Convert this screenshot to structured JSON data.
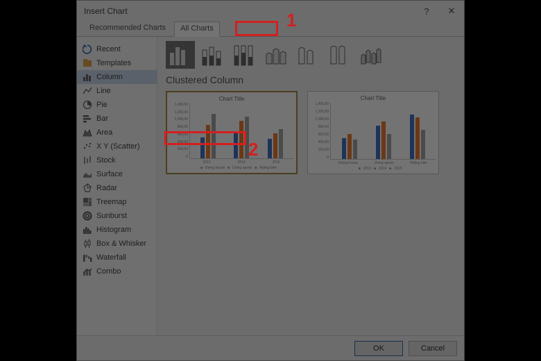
{
  "dialog": {
    "title": "Insert Chart",
    "help": "?",
    "close": "✕"
  },
  "tabs": {
    "recommended": "Recommended Charts",
    "all": "All Charts"
  },
  "sidebar": {
    "items": [
      {
        "label": "Recent"
      },
      {
        "label": "Templates"
      },
      {
        "label": "Column"
      },
      {
        "label": "Line"
      },
      {
        "label": "Pie"
      },
      {
        "label": "Bar"
      },
      {
        "label": "Area"
      },
      {
        "label": "X Y (Scatter)"
      },
      {
        "label": "Stock"
      },
      {
        "label": "Surface"
      },
      {
        "label": "Radar"
      },
      {
        "label": "Treemap"
      },
      {
        "label": "Sunburst"
      },
      {
        "label": "Histogram"
      },
      {
        "label": "Box & Whisker"
      },
      {
        "label": "Waterfall"
      },
      {
        "label": "Combo"
      }
    ]
  },
  "main": {
    "section_title": "Clustered Column",
    "preview_title": "Chart Title",
    "yticks": [
      "1,400,00",
      "1,200,00",
      "1,000,00",
      "800,00",
      "600,00",
      "400,00",
      "200,00",
      "0"
    ],
    "xcats1": [
      "2013",
      "2014",
      "2015"
    ],
    "legend1": [
      "Doing house",
      "Doing sports",
      "Riding bike"
    ],
    "xcats2": [
      "Doing house",
      "Doing sports",
      "Riding bike"
    ],
    "legend2": [
      "2013",
      "2014",
      "2015"
    ]
  },
  "footer": {
    "ok": "OK",
    "cancel": "Cancel"
  },
  "annotations": {
    "n1": "1",
    "n2": "2"
  },
  "chart_data": {
    "type": "bar",
    "title": "Chart Title",
    "ylim": [
      0,
      1400000
    ],
    "previews": [
      {
        "categories": [
          "2013",
          "2014",
          "2015"
        ],
        "series": [
          {
            "name": "Doing house",
            "values": [
              500000,
              600000,
              450000
            ]
          },
          {
            "name": "Doing sports",
            "values": [
              800000,
              900000,
              600000
            ]
          },
          {
            "name": "Riding bike",
            "values": [
              1100000,
              1000000,
              700000
            ]
          }
        ]
      },
      {
        "categories": [
          "Doing house",
          "Doing sports",
          "Riding bike"
        ],
        "series": [
          {
            "name": "2013",
            "values": [
              500000,
              800000,
              1100000
            ]
          },
          {
            "name": "2014",
            "values": [
              600000,
              900000,
              1000000
            ]
          },
          {
            "name": "2015",
            "values": [
              450000,
              600000,
              700000
            ]
          }
        ]
      }
    ]
  }
}
